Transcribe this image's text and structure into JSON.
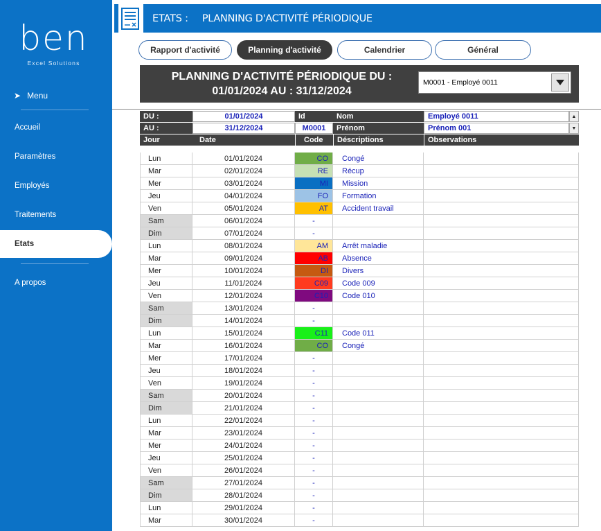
{
  "sidebar": {
    "logo_word": "ben",
    "logo_sub": "Excel Solutions",
    "menu_label": "Menu",
    "items": [
      "Accueil",
      "Paramètres",
      "Employés",
      "Traitements",
      "Etats",
      "A propos"
    ],
    "active_item": "Etats"
  },
  "header": {
    "icon": "report-form-icon",
    "title": "ETATS :",
    "subtitle": "PLANNING D'ACTIVITÉ PÉRIODIQUE"
  },
  "tabs": [
    "Rapport d'activité",
    "Planning d'activité",
    "Calendrier",
    "Général"
  ],
  "active_tab": "Planning d'activité",
  "band": {
    "line1": "PLANNING D'ACTIVITÉ PÉRIODIQUE DU :",
    "line2": "01/01/2024 AU : 31/12/2024",
    "employee_select": "M0001 - Employé 0011"
  },
  "info": {
    "du_label": "DU :",
    "du_value": "01/01/2024",
    "au_label": "AU :",
    "au_value": "31/12/2024",
    "id_label": "Id",
    "id_value": "M0001",
    "nom_label": "Nom",
    "nom_value": "Employé 0011",
    "prenom_label": "Prénom",
    "prenom_value": "Prénom 001"
  },
  "columns": [
    "Jour",
    "Date",
    "Code",
    "Déscriptions",
    "Observations"
  ],
  "colors": {
    "sidebar": "#0c72c6",
    "band": "#404040",
    "text_blue": "#1a22b8",
    "weekend": "#d9d9d9"
  },
  "rows": [
    {
      "jour": "Lun",
      "date": "01/01/2024",
      "code": "CO",
      "desc": "Congé",
      "color": "#70ad47",
      "weekend": false
    },
    {
      "jour": "Mar",
      "date": "02/01/2024",
      "code": "RE",
      "desc": "Récup",
      "color": "#c6e0b4",
      "weekend": false
    },
    {
      "jour": "Mer",
      "date": "03/01/2024",
      "code": "MI",
      "desc": "Mission",
      "color": "#0a6fc2",
      "weekend": false
    },
    {
      "jour": "Jeu",
      "date": "04/01/2024",
      "code": "FO",
      "desc": "Formation",
      "color": "#9dc3e6",
      "weekend": false
    },
    {
      "jour": "Ven",
      "date": "05/01/2024",
      "code": "AT",
      "desc": "Accident travail",
      "color": "#ffc000",
      "weekend": false
    },
    {
      "jour": "Sam",
      "date": "06/01/2024",
      "code": "-",
      "desc": "",
      "color": "",
      "weekend": true
    },
    {
      "jour": "Dim",
      "date": "07/01/2024",
      "code": "-",
      "desc": "",
      "color": "",
      "weekend": true
    },
    {
      "jour": "Lun",
      "date": "08/01/2024",
      "code": "AM",
      "desc": "Arrêt maladie",
      "color": "#ffe699",
      "weekend": false
    },
    {
      "jour": "Mar",
      "date": "09/01/2024",
      "code": "AB",
      "desc": "Absence",
      "color": "#ff0000",
      "weekend": false
    },
    {
      "jour": "Mer",
      "date": "10/01/2024",
      "code": "DI",
      "desc": "Divers",
      "color": "#c55a11",
      "weekend": false
    },
    {
      "jour": "Jeu",
      "date": "11/01/2024",
      "code": "C09",
      "desc": "Code 009",
      "color": "#ff3b1f",
      "weekend": false
    },
    {
      "jour": "Ven",
      "date": "12/01/2024",
      "code": "C10",
      "desc": "Code 010",
      "color": "#7f0a7f",
      "weekend": false
    },
    {
      "jour": "Sam",
      "date": "13/01/2024",
      "code": "-",
      "desc": "",
      "color": "",
      "weekend": true
    },
    {
      "jour": "Dim",
      "date": "14/01/2024",
      "code": "-",
      "desc": "",
      "color": "",
      "weekend": true
    },
    {
      "jour": "Lun",
      "date": "15/01/2024",
      "code": "C11",
      "desc": "Code 011",
      "color": "#19f019",
      "weekend": false
    },
    {
      "jour": "Mar",
      "date": "16/01/2024",
      "code": "CO",
      "desc": "Congé",
      "color": "#70ad47",
      "weekend": false
    },
    {
      "jour": "Mer",
      "date": "17/01/2024",
      "code": "-",
      "desc": "",
      "color": "",
      "weekend": false
    },
    {
      "jour": "Jeu",
      "date": "18/01/2024",
      "code": "-",
      "desc": "",
      "color": "",
      "weekend": false
    },
    {
      "jour": "Ven",
      "date": "19/01/2024",
      "code": "-",
      "desc": "",
      "color": "",
      "weekend": false
    },
    {
      "jour": "Sam",
      "date": "20/01/2024",
      "code": "-",
      "desc": "",
      "color": "",
      "weekend": true
    },
    {
      "jour": "Dim",
      "date": "21/01/2024",
      "code": "-",
      "desc": "",
      "color": "",
      "weekend": true
    },
    {
      "jour": "Lun",
      "date": "22/01/2024",
      "code": "-",
      "desc": "",
      "color": "",
      "weekend": false
    },
    {
      "jour": "Mar",
      "date": "23/01/2024",
      "code": "-",
      "desc": "",
      "color": "",
      "weekend": false
    },
    {
      "jour": "Mer",
      "date": "24/01/2024",
      "code": "-",
      "desc": "",
      "color": "",
      "weekend": false
    },
    {
      "jour": "Jeu",
      "date": "25/01/2024",
      "code": "-",
      "desc": "",
      "color": "",
      "weekend": false
    },
    {
      "jour": "Ven",
      "date": "26/01/2024",
      "code": "-",
      "desc": "",
      "color": "",
      "weekend": false
    },
    {
      "jour": "Sam",
      "date": "27/01/2024",
      "code": "-",
      "desc": "",
      "color": "",
      "weekend": true
    },
    {
      "jour": "Dim",
      "date": "28/01/2024",
      "code": "-",
      "desc": "",
      "color": "",
      "weekend": true
    },
    {
      "jour": "Lun",
      "date": "29/01/2024",
      "code": "-",
      "desc": "",
      "color": "",
      "weekend": false
    },
    {
      "jour": "Mar",
      "date": "30/01/2024",
      "code": "-",
      "desc": "",
      "color": "",
      "weekend": false
    }
  ]
}
